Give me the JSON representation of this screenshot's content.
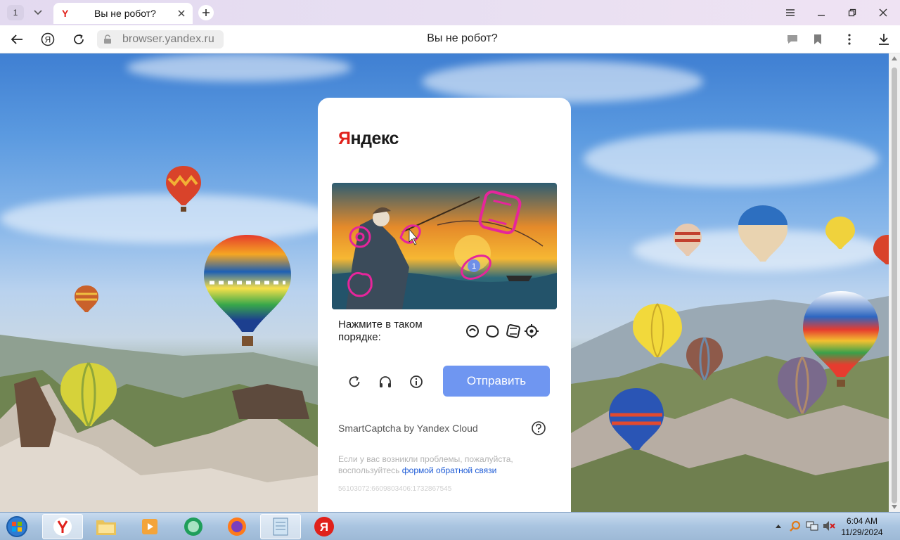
{
  "browser": {
    "tab_count": "1",
    "tab_title": "Вы не робот?",
    "url": "browser.yandex.ru",
    "page_title": "Вы не робот?"
  },
  "captcha": {
    "logo_first": "Я",
    "logo_rest": "ндекс",
    "instruction": "Нажмите в таком порядке:",
    "image_marker": "1",
    "order_icons": [
      "swirl-icon",
      "fist-icon",
      "film-icon",
      "gear-flower-icon"
    ],
    "submit_label": "Отправить",
    "smartcaptcha_label": "SmartCaptcha by Yandex Cloud",
    "problem_text": "Если у вас возникли проблемы, пожалуйста, воспользуйтесь",
    "feedback_link": "формой обратной связи",
    "request_id": "56103072:6609803406:1732867545"
  },
  "taskbar": {
    "apps": [
      "yandex-browser",
      "file-explorer",
      "media-player",
      "app-green",
      "firefox",
      "notepad",
      "yandex"
    ],
    "time": "6:04 AM",
    "date": "11/29/2024"
  },
  "colors": {
    "brand_red": "#e0211b",
    "submit_blue": "#6f96f1",
    "link_blue": "#1d5bd6"
  }
}
